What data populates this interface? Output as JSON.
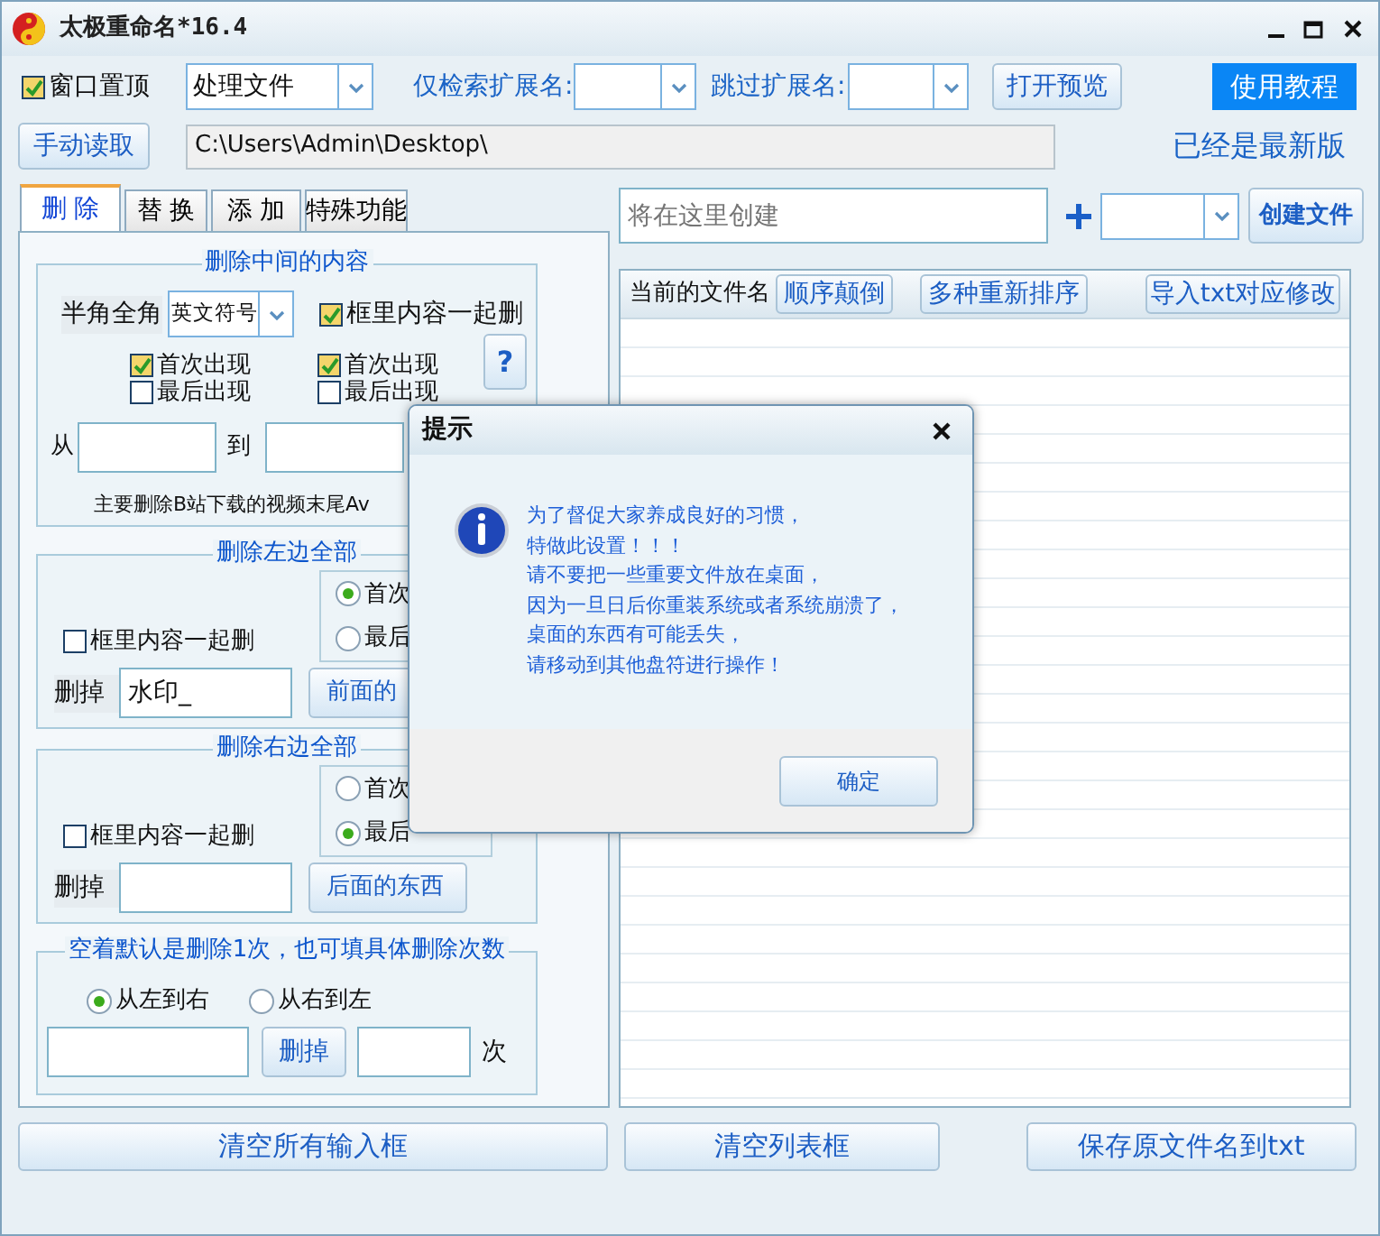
{
  "window": {
    "title": "太极重命名*16.4"
  },
  "toolbar": {
    "always_on_top": {
      "label": "窗口置顶",
      "checked": true
    },
    "mode_select": {
      "value": "处理文件"
    },
    "only_ext_label": "仅检索扩展名:",
    "skip_ext_label": "跳过扩展名:",
    "preview_button": "打开预览",
    "tutorial_button": "使用教程"
  },
  "path_bar": {
    "read_button": "手动读取",
    "path": "C:\\Users\\Admin\\Desktop\\",
    "version_status": "已经是最新版"
  },
  "tabs": [
    {
      "label": "删 除",
      "selected": true
    },
    {
      "label": "替 换",
      "selected": false
    },
    {
      "label": "添 加",
      "selected": false
    },
    {
      "label": "特殊功能",
      "selected": false
    }
  ],
  "delete_middle": {
    "title": "删除中间的内容",
    "width_label": "半角全角",
    "width_select": "英文符号",
    "include_brackets": {
      "label": "框里内容一起删",
      "checked": true
    },
    "left_checks": [
      {
        "label": "首次出现",
        "checked": true
      },
      {
        "label": "最后出现",
        "checked": false
      }
    ],
    "right_checks": [
      {
        "label": "首次出现",
        "checked": true
      },
      {
        "label": "最后出现",
        "checked": false
      }
    ],
    "help_button": "?",
    "from_label": "从",
    "to_label": "到",
    "note": "主要删除B站下载的视频末尾Av"
  },
  "delete_left": {
    "title": "删除左边全部",
    "include_brackets": {
      "label": "框里内容一起删",
      "checked": false
    },
    "radios": [
      {
        "label": "首次",
        "selected": true
      },
      {
        "label": "最后",
        "selected": false
      }
    ],
    "delete_label": "删掉",
    "value": "水印_",
    "button": "前面的"
  },
  "delete_right": {
    "title": "删除右边全部",
    "include_brackets": {
      "label": "框里内容一起删",
      "checked": false
    },
    "radios": [
      {
        "label": "首次",
        "selected": false
      },
      {
        "label": "最后",
        "selected": true
      }
    ],
    "delete_label": "删掉",
    "button": "后面的东西"
  },
  "delete_count": {
    "title": "空着默认是删除1次，也可填具体删除次数",
    "radios": [
      {
        "label": "从左到右",
        "selected": true
      },
      {
        "label": "从右到左",
        "selected": false
      }
    ],
    "button": "删掉",
    "unit": "次"
  },
  "create": {
    "placeholder": "将在这里创建",
    "button": "创建文件"
  },
  "file_list": {
    "column": "当前的文件名",
    "buttons": [
      "顺序颠倒",
      "多种重新排序",
      "导入txt对应修改"
    ]
  },
  "bottom_buttons": [
    "清空所有输入框",
    "清空列表框",
    "保存原文件名到txt"
  ],
  "dialog": {
    "title": "提示",
    "lines": [
      "为了督促大家养成良好的习惯，",
      "特做此设置！！！",
      "请不要把一些重要文件放在桌面，",
      "因为一旦日后你重装系统或者系统崩溃了，",
      "桌面的东西有可能丢失，",
      "请移动到其他盘符进行操作！"
    ],
    "ok_button": "确定"
  }
}
